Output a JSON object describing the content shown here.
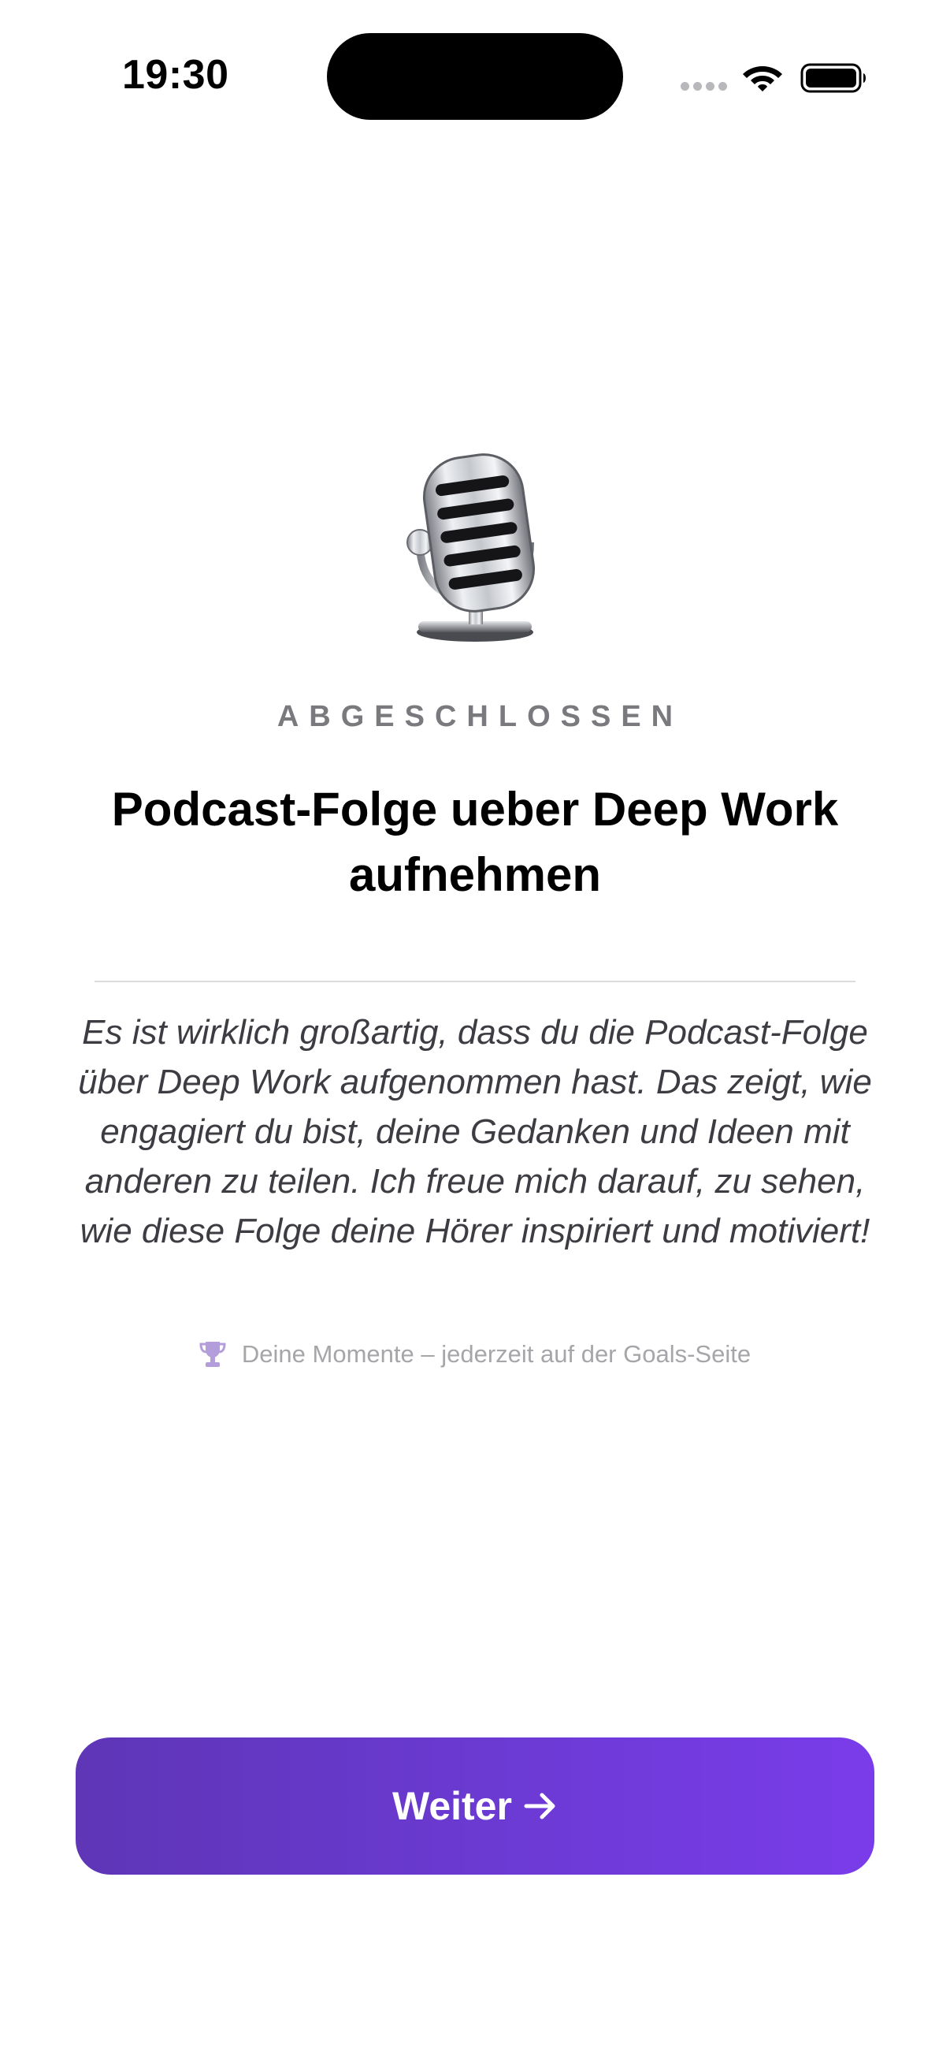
{
  "status_bar": {
    "time": "19:30"
  },
  "milestone": {
    "icon": "studio-microphone",
    "eyebrow": "ABGESCHLOSSEN",
    "title": "Podcast-Folge ueber Deep Work aufnehmen",
    "message": "Es ist wirklich großartig, dass du die Podcast-Folge über Deep Work aufgenommen hast. Das zeigt, wie engagiert du bist, deine Gedanken und Ideen mit anderen zu teilen. Ich freue mich darauf, zu sehen, wie diese Folge deine Hörer inspiriert und motiviert!",
    "hint_icon": "trophy",
    "hint": "Deine Momente – jederzeit auf der Goals-Seite"
  },
  "actions": {
    "continue_label": "Weiter",
    "continue_icon": "arrow-right"
  },
  "colors": {
    "accent_start": "#5e36b6",
    "accent_end": "#7a3cea",
    "hint_icon": "#b39ddb"
  }
}
